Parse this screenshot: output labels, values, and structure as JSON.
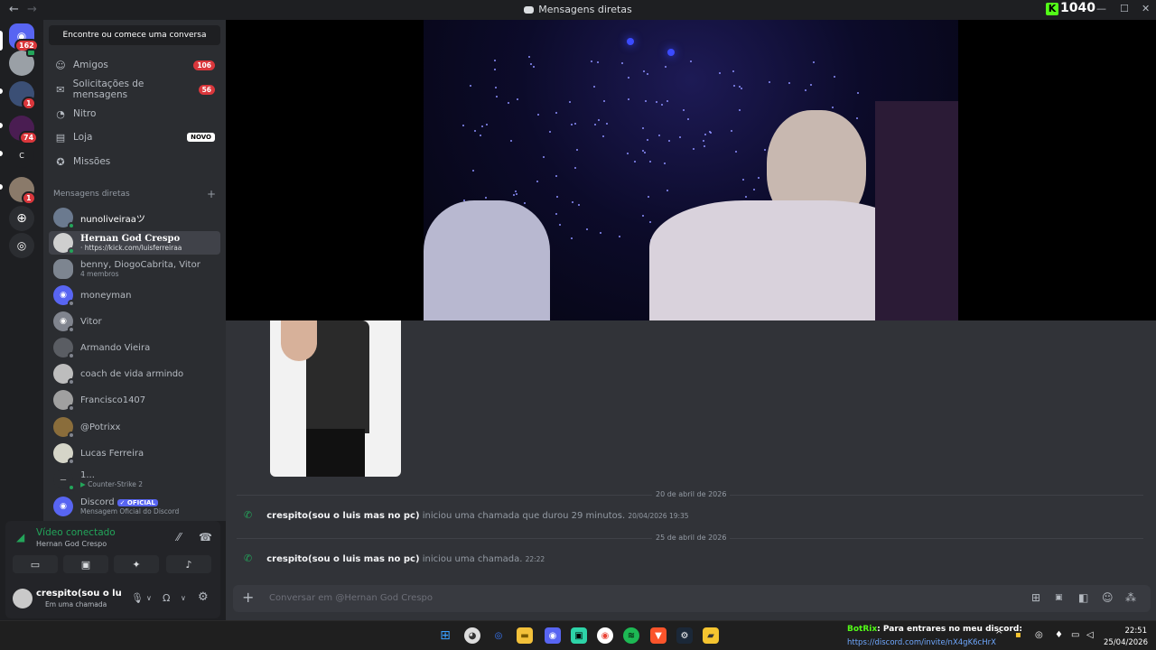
{
  "titlebar": {
    "title": "Mensagens diretas",
    "back": "←",
    "forward": "→",
    "kick_count": "1040",
    "minimize": "—",
    "maximize": "☐",
    "close": "✕"
  },
  "rail": {
    "home_badge": "162",
    "server2_badge": "1",
    "server3_badge": "74",
    "server4_label": "C",
    "server5_badge": "1"
  },
  "sidebar": {
    "search": "Encontre ou comece uma conversa",
    "nav": [
      {
        "label": "Amigos",
        "count": "106"
      },
      {
        "label": "Solicitações de mensagens",
        "count": "56"
      },
      {
        "label": "Nitro"
      },
      {
        "label": "Loja",
        "tag": "NOVO"
      },
      {
        "label": "Missões"
      }
    ],
    "dm_header": "Mensagens diretas",
    "dms": [
      {
        "name": "nunoliveiraaツ"
      },
      {
        "name": "Hernan God Crespo",
        "sub": "· https://kick.com/luisferreiraa"
      },
      {
        "name": "benny, DiogoCabrita, Vitor",
        "sub": "4 membros"
      },
      {
        "name": "moneyman"
      },
      {
        "name": "Vitor"
      },
      {
        "name": "Armando Vieira"
      },
      {
        "name": "coach de vida armindo"
      },
      {
        "name": "Francisco1407"
      },
      {
        "name": "@Potrixx"
      },
      {
        "name": "Lucas Ferreira"
      },
      {
        "name": "1...",
        "sub": "Counter-Strike 2"
      },
      {
        "name": "Discord",
        "tag": "✓ OFICIAL",
        "sub": "Mensagem Oficial do Discord"
      }
    ]
  },
  "voice": {
    "status": "Vídeo conectado",
    "channel": "Hernan God Crespo"
  },
  "user": {
    "name": "crespito(sou o luis...",
    "status": "Em uma chamada"
  },
  "chat": {
    "messages": [
      {
        "date": "20 de abril de 2026",
        "author": "crespito(sou o luis mas no pc)",
        "text": "iniciou uma chamada que durou 29 minutos.",
        "time": "20/04/2026 19:35"
      },
      {
        "date": "25 de abril de 2026",
        "author": "crespito(sou o luis mas no pc)",
        "text": "iniciou uma chamada.",
        "time": "22:22"
      }
    ],
    "composer_placeholder": "Conversar em @Hernan God Crespo"
  },
  "taskbar": {
    "botrix_name": "BotRix",
    "botrix_text": ": Para entrares no meu discord:",
    "botrix_link": "https://discord.com/invite/nX4gK6cHrX",
    "time": "22:51",
    "date": "25/04/2026"
  },
  "colors": {
    "accent": "#5865f2",
    "online": "#23a55a",
    "danger": "#da373c",
    "kick": "#53fc18"
  }
}
